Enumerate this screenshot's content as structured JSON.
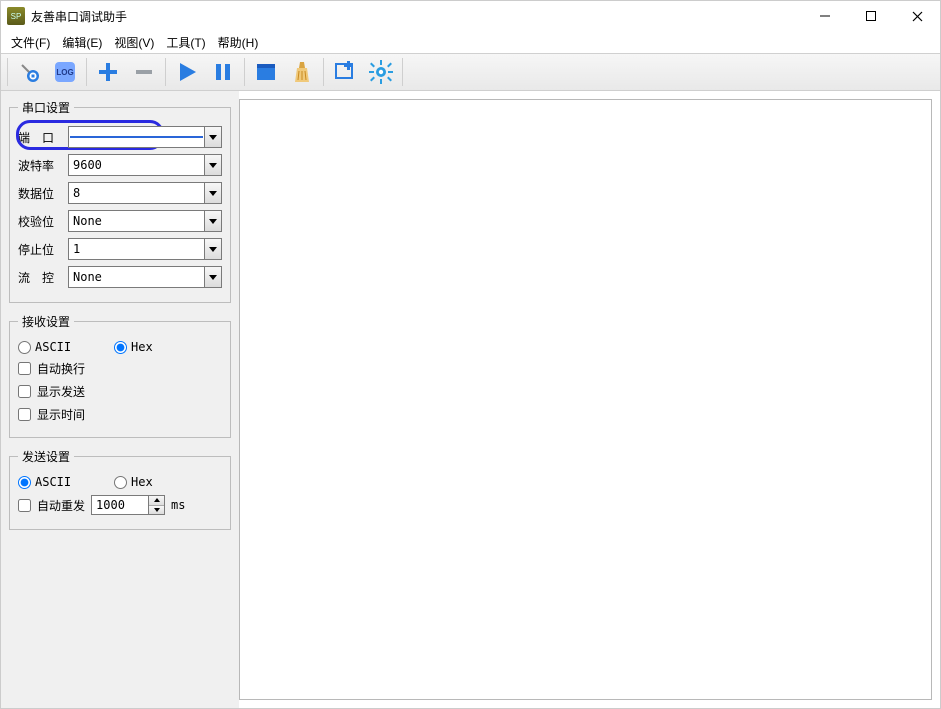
{
  "window": {
    "title": "友善串口调试助手"
  },
  "menu": {
    "file": "文件(F)",
    "edit": "编辑(E)",
    "view": "视图(V)",
    "tools": "工具(T)",
    "help": "帮助(H)"
  },
  "serial_settings": {
    "legend": "串口设置",
    "port_label": "端　口",
    "port_value": "",
    "baud_label": "波特率",
    "baud_value": "9600",
    "data_label": "数据位",
    "data_value": "8",
    "parity_label": "校验位",
    "parity_value": "None",
    "stop_label": "停止位",
    "stop_value": "1",
    "flow_label": "流　控",
    "flow_value": "None"
  },
  "recv_settings": {
    "legend": "接收设置",
    "ascii": "ASCII",
    "hex": "Hex",
    "wrap": "自动换行",
    "show_send": "显示发送",
    "show_time": "显示时间"
  },
  "send_settings": {
    "legend": "发送设置",
    "ascii": "ASCII",
    "hex": "Hex",
    "auto_resend": "自动重发",
    "interval": "1000",
    "unit": "ms"
  }
}
